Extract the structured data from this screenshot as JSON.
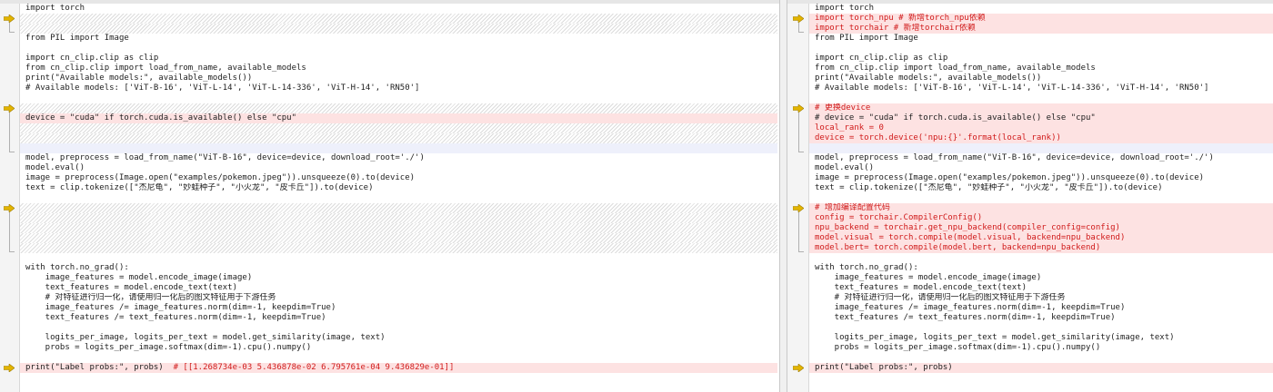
{
  "left_lines": [
    {
      "t": "import torch",
      "k": "n"
    },
    {
      "t": "",
      "k": "f"
    },
    {
      "t": "",
      "k": "f"
    },
    {
      "t": "from PIL import Image",
      "k": "n"
    },
    {
      "t": "",
      "k": "n"
    },
    {
      "t": "import cn_clip.clip as clip",
      "k": "n"
    },
    {
      "t": "from cn_clip.clip import load_from_name, available_models",
      "k": "n"
    },
    {
      "t": "print(\"Available models:\", available_models())",
      "k": "n"
    },
    {
      "t": "# Available models: ['ViT-B-16', 'ViT-L-14', 'ViT-L-14-336', 'ViT-H-14', 'RN50']",
      "k": "n"
    },
    {
      "t": "",
      "k": "n"
    },
    {
      "t": "",
      "k": "f"
    },
    {
      "t": "device = \"cuda\" if torch.cuda.is_available() else \"cpu\"",
      "k": "cp"
    },
    {
      "t": "",
      "k": "f"
    },
    {
      "t": "",
      "k": "f"
    },
    {
      "t": "",
      "k": "w"
    },
    {
      "t": "model, preprocess = load_from_name(\"ViT-B-16\", device=device, download_root='./')",
      "k": "n"
    },
    {
      "t": "model.eval()",
      "k": "n"
    },
    {
      "t": "image = preprocess(Image.open(\"examples/pokemon.jpeg\")).unsqueeze(0).to(device)",
      "k": "n"
    },
    {
      "t": "text = clip.tokenize([\"杰尼龟\", \"妙蛙种子\", \"小火龙\", \"皮卡丘\"]).to(device)",
      "k": "n"
    },
    {
      "t": "",
      "k": "n"
    },
    {
      "t": "",
      "k": "f"
    },
    {
      "t": "",
      "k": "f"
    },
    {
      "t": "",
      "k": "f"
    },
    {
      "t": "",
      "k": "f"
    },
    {
      "t": "",
      "k": "f"
    },
    {
      "t": "",
      "k": "n"
    },
    {
      "t": "with torch.no_grad():",
      "k": "n"
    },
    {
      "t": "    image_features = model.encode_image(image)",
      "k": "n"
    },
    {
      "t": "    text_features = model.encode_text(text)",
      "k": "n"
    },
    {
      "t": "    # 对特征进行归一化，请使用归一化后的图文特征用于下游任务",
      "k": "n"
    },
    {
      "t": "    image_features /= image_features.norm(dim=-1, keepdim=True)",
      "k": "n"
    },
    {
      "t": "    text_features /= text_features.norm(dim=-1, keepdim=True)",
      "k": "n"
    },
    {
      "t": "",
      "k": "n"
    },
    {
      "t": "    logits_per_image, logits_per_text = model.get_similarity(image, text)",
      "k": "n"
    },
    {
      "t": "    probs = logits_per_image.softmax(dim=-1).cpu().numpy()",
      "k": "n"
    },
    {
      "t": "",
      "k": "n"
    },
    {
      "t": "print(\"Label probs:\", probs)  # [[1.268734e-03 5.436878e-02 6.795761e-04 9.436829e-01]]",
      "k": "lp"
    }
  ],
  "right_lines": [
    {
      "t": "import torch",
      "k": "n"
    },
    {
      "t": "import torch_npu # 新增torch_npu依赖",
      "k": "c"
    },
    {
      "t": "import torchair # 新增torchair依赖",
      "k": "c"
    },
    {
      "t": "from PIL import Image",
      "k": "n"
    },
    {
      "t": "",
      "k": "n"
    },
    {
      "t": "import cn_clip.clip as clip",
      "k": "n"
    },
    {
      "t": "from cn_clip.clip import load_from_name, available_models",
      "k": "n"
    },
    {
      "t": "print(\"Available models:\", available_models())",
      "k": "n"
    },
    {
      "t": "# Available models: ['ViT-B-16', 'ViT-L-14', 'ViT-L-14-336', 'ViT-H-14', 'RN50']",
      "k": "n"
    },
    {
      "t": "",
      "k": "n"
    },
    {
      "t": "# 更换device",
      "k": "c"
    },
    {
      "t": "# device = \"cuda\" if torch.cuda.is_available() else \"cpu\"",
      "k": "cp"
    },
    {
      "t": "local_rank = 0",
      "k": "c"
    },
    {
      "t": "device = torch.device('npu:{}'.format(local_rank))",
      "k": "c"
    },
    {
      "t": "",
      "k": "w"
    },
    {
      "t": "model, preprocess = load_from_name(\"ViT-B-16\", device=device, download_root='./')",
      "k": "n"
    },
    {
      "t": "model.eval()",
      "k": "n"
    },
    {
      "t": "image = preprocess(Image.open(\"examples/pokemon.jpeg\")).unsqueeze(0).to(device)",
      "k": "n"
    },
    {
      "t": "text = clip.tokenize([\"杰尼龟\", \"妙蛙种子\", \"小火龙\", \"皮卡丘\"]).to(device)",
      "k": "n"
    },
    {
      "t": "",
      "k": "n"
    },
    {
      "t": "# 增加编译配置代码",
      "k": "c"
    },
    {
      "t": "config = torchair.CompilerConfig()",
      "k": "c"
    },
    {
      "t": "npu_backend = torchair.get_npu_backend(compiler_config=config)",
      "k": "c"
    },
    {
      "t": "model.visual = torch.compile(model.visual, backend=npu_backend)",
      "k": "c"
    },
    {
      "t": "model.bert= torch.compile(model.bert, backend=npu_backend)",
      "k": "c"
    },
    {
      "t": "",
      "k": "n"
    },
    {
      "t": "with torch.no_grad():",
      "k": "n"
    },
    {
      "t": "    image_features = model.encode_image(image)",
      "k": "n"
    },
    {
      "t": "    text_features = model.encode_text(text)",
      "k": "n"
    },
    {
      "t": "    # 对特征进行归一化，请使用归一化后的图文特征用于下游任务",
      "k": "n"
    },
    {
      "t": "    image_features /= image_features.norm(dim=-1, keepdim=True)",
      "k": "n"
    },
    {
      "t": "    text_features /= text_features.norm(dim=-1, keepdim=True)",
      "k": "n"
    },
    {
      "t": "",
      "k": "n"
    },
    {
      "t": "    logits_per_image, logits_per_text = model.get_similarity(image, text)",
      "k": "n"
    },
    {
      "t": "    probs = logits_per_image.softmax(dim=-1).cpu().numpy()",
      "k": "n"
    },
    {
      "t": "",
      "k": "n"
    },
    {
      "t": "print(\"Label probs:\", probs)",
      "k": "cp"
    }
  ],
  "colors": {
    "changed_bg": "#fde2e2",
    "changed_text": "#d01a1a",
    "marker": "#e2b400",
    "filler_stripe": "#dcdcdc"
  },
  "icons": {
    "change_marker": "arrow-right-icon"
  }
}
